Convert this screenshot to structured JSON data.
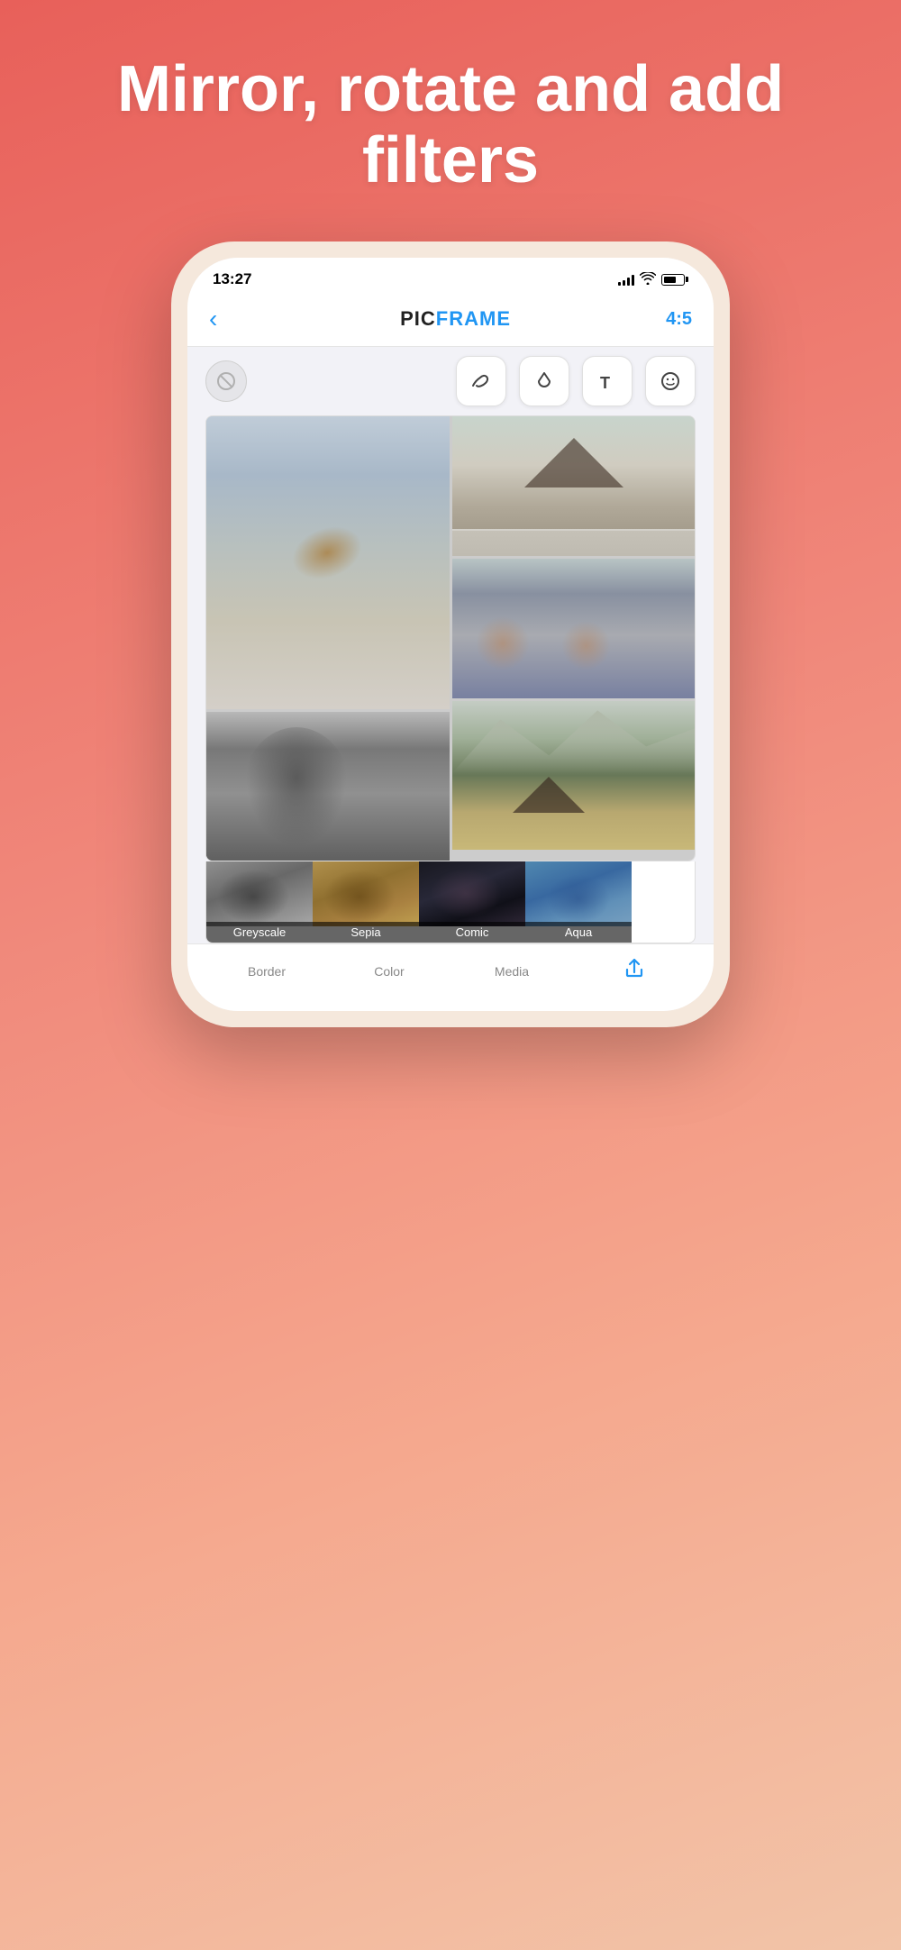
{
  "hero": {
    "title": "Mirror, rotate and add filters"
  },
  "status_bar": {
    "time": "13:27",
    "aspect_ratio": "4:5"
  },
  "nav": {
    "back_label": "‹",
    "app_name_part1": "PIC",
    "app_name_part2": "FRAME",
    "aspect": "4:5"
  },
  "toolbar": {
    "brush_icon": "〜",
    "drop_icon": "◇",
    "text_icon": "T",
    "emoji_icon": "☺"
  },
  "filters": [
    {
      "id": "greyscale",
      "label": "Greyscale",
      "css_class": "ft-grey"
    },
    {
      "id": "sepia",
      "label": "Sepia",
      "css_class": "ft-sepia"
    },
    {
      "id": "comic",
      "label": "Comic",
      "css_class": "ft-comic"
    },
    {
      "id": "aqua",
      "label": "Aqua",
      "css_class": "ft-aqua"
    }
  ],
  "tabs": [
    {
      "id": "border",
      "label": "Border",
      "active": false
    },
    {
      "id": "color",
      "label": "Color",
      "active": false
    },
    {
      "id": "media",
      "label": "Media",
      "active": false
    },
    {
      "id": "share",
      "label": "",
      "active": true
    }
  ]
}
